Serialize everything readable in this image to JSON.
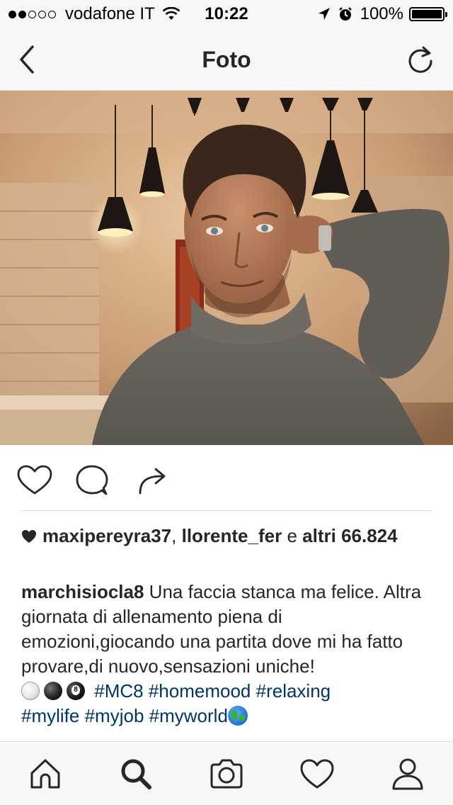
{
  "status_bar": {
    "carrier": "vodafone IT",
    "time": "10:22",
    "battery": "100%"
  },
  "nav": {
    "title": "Foto"
  },
  "likes": {
    "users": [
      "maxipereyra37",
      "llorente_fer"
    ],
    "separator": ",",
    "conjunction": "e",
    "others_label": "altri",
    "others_count": "66.824"
  },
  "caption": {
    "username": "marchisiocla8",
    "text": "Una faccia stanca ma felice. Altra giornata di allenamento piena di emozioni,giocando una partita dove mi ha fatto provare,di nuovo,sensazioni uniche!",
    "hashtags_line1": [
      "#MC8",
      "#homemood",
      "#relaxing"
    ],
    "hashtags_line2": [
      "#mylife",
      "#myjob",
      "#myworld"
    ]
  },
  "icons": {
    "back": "chevron-left-icon",
    "refresh": "refresh-icon",
    "like": "heart-icon",
    "comment": "comment-icon",
    "share": "share-icon",
    "tabs": [
      "home-icon",
      "search-icon",
      "camera-icon",
      "heart-icon",
      "profile-icon"
    ]
  },
  "colors": {
    "hashtag": "#003569",
    "text": "#262626",
    "bar_background": "#f7f7f7"
  }
}
